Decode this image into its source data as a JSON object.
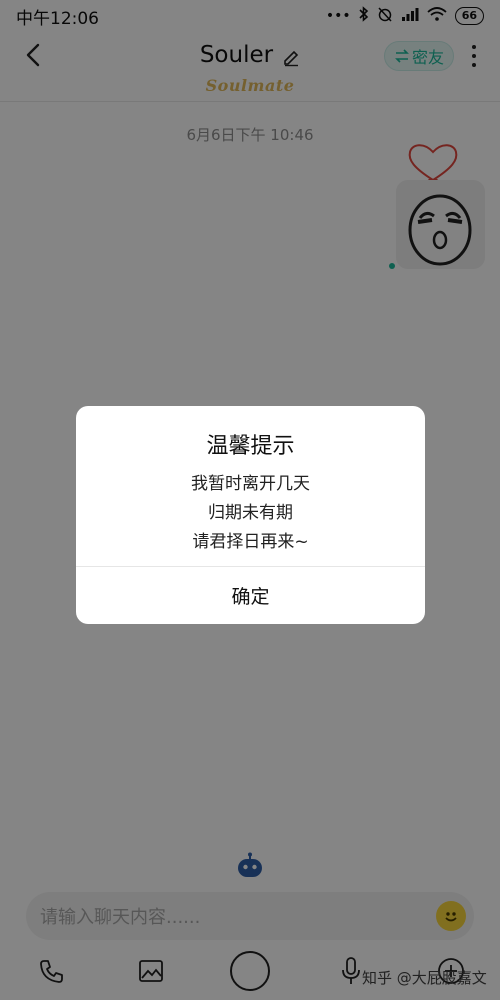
{
  "status_bar": {
    "time": "中午12:06",
    "battery": "66"
  },
  "header": {
    "title": "Souler",
    "subtitle": "Soulmate",
    "friend_label": "密友"
  },
  "chat": {
    "timestamp": "6月6日下午 10:46"
  },
  "dialog": {
    "title": "温馨提示",
    "lines": [
      "我暂时离开几天",
      "归期未有期",
      "请君择日再来~"
    ],
    "confirm": "确定"
  },
  "input": {
    "placeholder": "请输入聊天内容......"
  },
  "watermark": "知乎 @大屁股嘉文",
  "colors": {
    "accent": "#1bb99a",
    "subtitle": "#e0b85a",
    "heart": "#e0473e",
    "overlay": "rgba(0,0,0,0.48)"
  },
  "icons": [
    "back-icon",
    "edit-icon",
    "swap-icon",
    "more-icon",
    "heart-icon",
    "robot-icon",
    "emoji-icon",
    "phone-icon",
    "image-icon",
    "mic-icon",
    "add-icon"
  ]
}
